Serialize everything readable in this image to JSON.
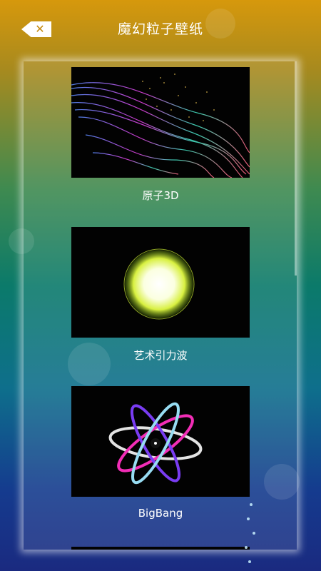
{
  "header": {
    "title": "魔幻粒子壁纸",
    "back_label": "✕"
  },
  "wallpapers": [
    {
      "name": "原子3D",
      "thumb": "particle-swirl"
    },
    {
      "name": "艺术引力波",
      "thumb": "gravity-orb"
    },
    {
      "name": "BigBang",
      "thumb": "atom-orbits"
    }
  ],
  "colors": {
    "gradient_top": "#d6980c",
    "gradient_mid": "#0b7a6a",
    "gradient_bottom": "#1a2a80"
  }
}
